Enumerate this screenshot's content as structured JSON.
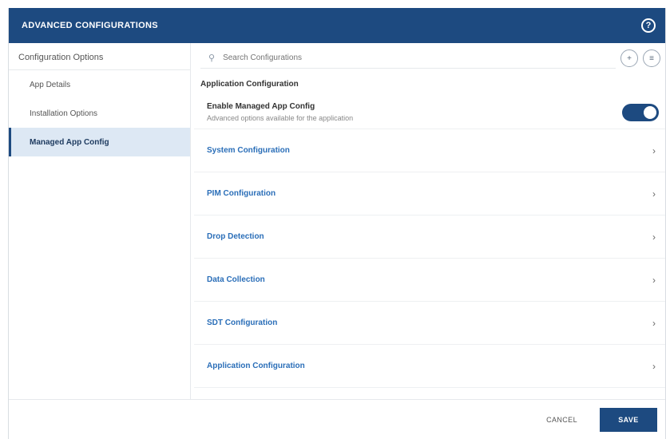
{
  "header": {
    "title": "ADVANCED CONFIGURATIONS",
    "help_icon": "?"
  },
  "sidebar": {
    "heading": "Configuration Options",
    "items": [
      {
        "label": "App Details",
        "active": false
      },
      {
        "label": "Installation Options",
        "active": false
      },
      {
        "label": "Managed App Config",
        "active": true
      }
    ]
  },
  "toolbar": {
    "search_placeholder": "Search Configurations",
    "icons": [
      "search-icon",
      "add-icon",
      "code-icon"
    ]
  },
  "main": {
    "section_title": "Application Configuration",
    "toggle": {
      "label": "Enable Managed App Config",
      "description": "Advanced options available for the application",
      "on": true
    },
    "rows": [
      {
        "label": "System Configuration"
      },
      {
        "label": "PIM Configuration"
      },
      {
        "label": "Drop Detection"
      },
      {
        "label": "Data Collection"
      },
      {
        "label": "SDT Configuration"
      },
      {
        "label": "Application Configuration"
      }
    ]
  },
  "footer": {
    "cancel_label": "CANCEL",
    "save_label": "SAVE"
  },
  "colors": {
    "brand": "#1d4a80",
    "link": "#2a6eb8",
    "active_bg": "#dde8f4"
  }
}
